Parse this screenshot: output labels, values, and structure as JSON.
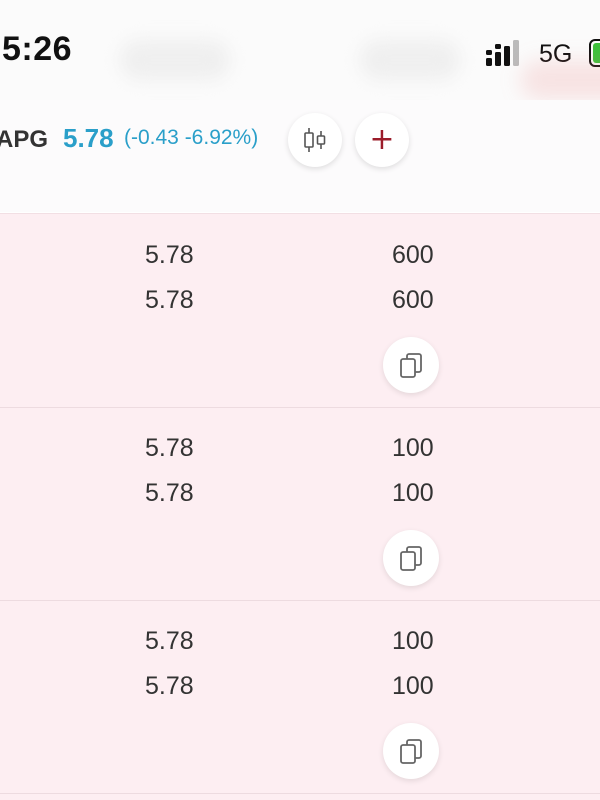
{
  "status_bar": {
    "time": "5:26",
    "network": "5G",
    "signal_icon": "signal-bars-icon",
    "battery_icon": "battery-icon"
  },
  "quote": {
    "symbol": "APG",
    "price": "5.78",
    "change": "(-0.43 -6.92%)",
    "chart_button_icon": "candlestick-chart-icon",
    "add_button_icon": "plus-icon",
    "price_color": "#2a9fc9",
    "add_color": "#9b1c2a"
  },
  "rows": [
    {
      "price_a": "5.78",
      "price_b": "5.78",
      "qty_a": "600",
      "qty_b": "600",
      "action_icon": "copy-icon"
    },
    {
      "price_a": "5.78",
      "price_b": "5.78",
      "qty_a": "100",
      "qty_b": "100",
      "action_icon": "copy-icon"
    },
    {
      "price_a": "5.78",
      "price_b": "5.78",
      "qty_a": "100",
      "qty_b": "100",
      "action_icon": "copy-icon"
    }
  ],
  "colors": {
    "row_background": "#fdeef2",
    "divider": "#eddbe0"
  }
}
